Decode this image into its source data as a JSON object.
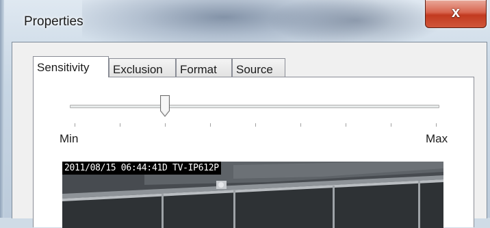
{
  "window": {
    "title": "Properties",
    "close_label": "x"
  },
  "tabs": [
    {
      "label": "Sensitivity",
      "active": true
    },
    {
      "label": "Exclusion",
      "active": false
    },
    {
      "label": "Format",
      "active": false
    },
    {
      "label": "Source",
      "active": false
    }
  ],
  "sensitivity": {
    "min_label": "Min",
    "max_label": "Max",
    "slider_value_fraction": 0.25,
    "tick_count": 9
  },
  "preview": {
    "overlay_text": "2011/08/15 06:44:41D TV-IP612P"
  }
}
